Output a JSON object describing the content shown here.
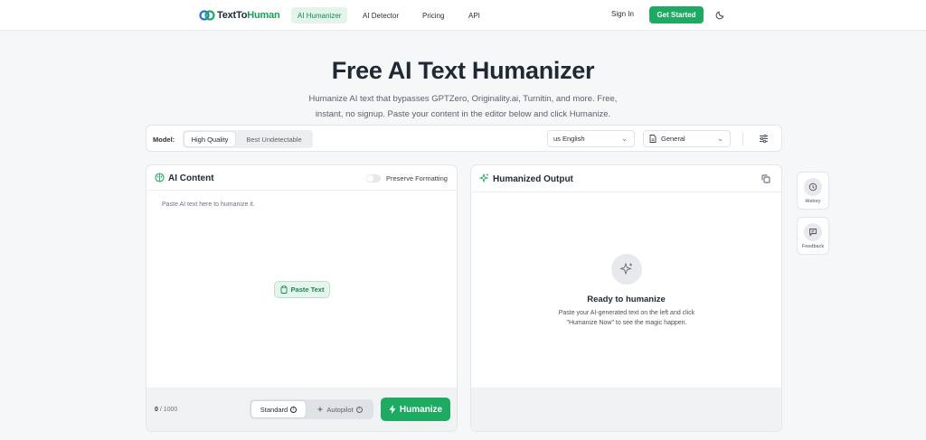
{
  "nav": {
    "logo_part1": "TextTo",
    "logo_part2": "Human",
    "links": [
      "AI Humanizer",
      "AI Detector",
      "Pricing",
      "API"
    ],
    "signin": "Sign In",
    "cta": "Get Started"
  },
  "hero": {
    "title": "Free AI Text Humanizer",
    "subtitle": "Humanize AI text that bypasses GPTZero, Originality.ai, Turnitin, and more. Free, instant, no signup. Paste your content in the editor below and click Humanize."
  },
  "toolbar": {
    "model_label": "Model:",
    "models": [
      "High Quality",
      "Best Undetectable"
    ],
    "selected_model": "High Quality",
    "language": "us English",
    "style": "General"
  },
  "input_panel": {
    "title": "AI Content",
    "preserve_label": "Preserve Formatting",
    "placeholder": "Paste AI text here to humanize it.",
    "paste_label": "Paste Text",
    "count": "0",
    "count_max": "/ 1000",
    "modes": [
      "Standard",
      "Autopilot"
    ],
    "selected_mode": "Standard",
    "humanize_label": "Humanize"
  },
  "output_panel": {
    "title": "Humanized Output",
    "ready_title": "Ready to humanize",
    "ready_sub": "Paste your AI-generated text on the left and click \"Humanize Now\" to see the magic happen."
  },
  "side": {
    "history": "History",
    "feedback": "Feedback"
  },
  "colors": {
    "brand": "#1faa63",
    "brand_light": "#e3f4ea",
    "text": "#1f2933"
  }
}
